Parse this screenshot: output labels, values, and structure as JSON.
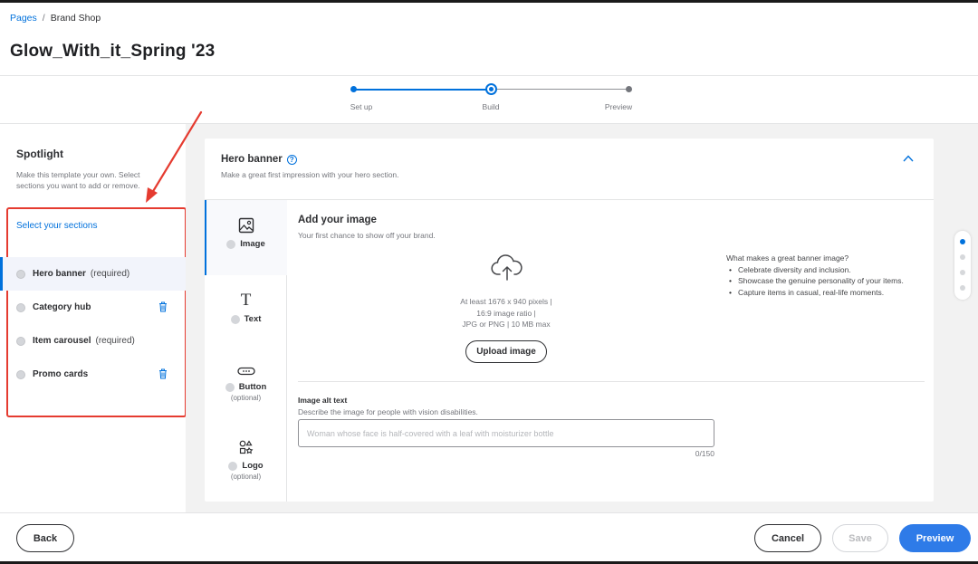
{
  "breadcrumb": {
    "link": "Pages",
    "separator": "/",
    "current": "Brand Shop"
  },
  "page_title": "Glow_With_it_Spring '23",
  "stepper": {
    "steps": [
      {
        "label": "Set up",
        "state": "complete"
      },
      {
        "label": "Build",
        "state": "current"
      },
      {
        "label": "Preview",
        "state": "upcoming"
      }
    ]
  },
  "left_panel": {
    "title": "Spotlight",
    "description": "Make this template your own. Select sections you want to add or remove.",
    "select_link": "Select your sections",
    "sections": [
      {
        "label": "Hero banner",
        "note": "(required)",
        "removable": false,
        "active": true
      },
      {
        "label": "Category hub",
        "note": "",
        "removable": true,
        "active": false
      },
      {
        "label": "Item carousel",
        "note": "(required)",
        "removable": false,
        "active": false
      },
      {
        "label": "Promo cards",
        "note": "",
        "removable": true,
        "active": false
      }
    ]
  },
  "hero": {
    "title": "Hero banner",
    "help_icon": "?",
    "description": "Make a great first impression with your hero section."
  },
  "tools": [
    {
      "label": "Image",
      "optional": "",
      "icon": "image-icon"
    },
    {
      "label": "Text",
      "optional": "",
      "icon": "text-icon",
      "glyph": "T"
    },
    {
      "label": "Button",
      "optional": "(optional)",
      "icon": "button-icon"
    },
    {
      "label": "Logo",
      "optional": "(optional)",
      "icon": "logo-icon"
    }
  ],
  "image_panel": {
    "title": "Add your image",
    "description": "Your first chance to show off your brand.",
    "requirements": [
      "At least 1676 x 940 pixels |",
      "16:9 image ratio |",
      "JPG or PNG | 10 MB max"
    ],
    "upload_button": "Upload image",
    "tips_title": "What makes a great banner image?",
    "tips": [
      "Celebrate diversity and inclusion.",
      "Showcase the genuine personality of your items.",
      "Capture items in casual, real-life moments."
    ],
    "alt_label": "Image alt text",
    "alt_description": "Describe the image for people with vision disabilities.",
    "alt_placeholder": "Woman whose face is half-covered with a leaf with moisturizer bottle",
    "alt_value": "",
    "char_count": "0/150"
  },
  "footer": {
    "back": "Back",
    "cancel": "Cancel",
    "save": "Save",
    "preview": "Preview"
  },
  "colors": {
    "accent": "#0071dc",
    "annotation": "#e53b30",
    "primary_button": "#2e7be8"
  }
}
